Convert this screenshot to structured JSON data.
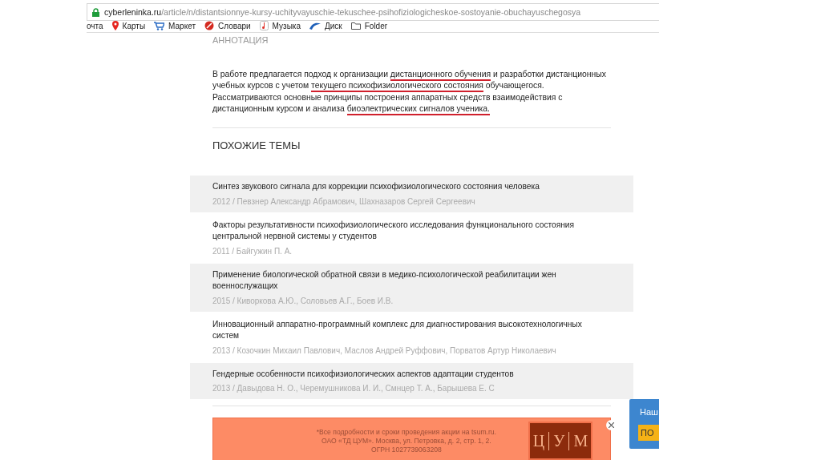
{
  "address_bar": {
    "domain": "cyberleninka.ru",
    "path": "/article/n/distantsionnye-kursy-uchityvayuschie-tekuschee-psihofiziologicheskoe-sostoyanie-obuchayuschegosya"
  },
  "bookmarks": [
    {
      "label": "очта",
      "kind": "none"
    },
    {
      "label": "Карты",
      "kind": "pin"
    },
    {
      "label": "Маркет",
      "kind": "cart"
    },
    {
      "label": "Словари",
      "kind": "dictionary"
    },
    {
      "label": "Музыка",
      "kind": "music"
    },
    {
      "label": "Диск",
      "kind": "disk"
    },
    {
      "label": "Folder",
      "kind": "folder"
    }
  ],
  "annotation": {
    "heading": "АННОТАЦИЯ",
    "segments": [
      {
        "text": "В работе предлагается подход к организации ",
        "underlined": false
      },
      {
        "text": "дистанционного обучения",
        "underlined": true
      },
      {
        "text": " и разработки дистанционных учебных курсов с учетом ",
        "underlined": false
      },
      {
        "text": "текущего психофизиологического состояния",
        "underlined": true
      },
      {
        "text": " обучающегося. Рассматриваются основные принципы построения аппаратных средств взаимодействия с дистанционным курсом и анализа ",
        "underlined": false
      },
      {
        "text": "биоэлектрических сигналов ученика.",
        "underlined": true
      }
    ]
  },
  "related": {
    "heading": "ПОХОЖИЕ ТЕМЫ",
    "items": [
      {
        "title": "Синтез звукового сигнала для коррекции психофизиологического состояния человека",
        "meta": "2012 / Певзнер Александр Абрамович, Шахназаров Сергей Сергеевич"
      },
      {
        "title": "Факторы результативности психофизиологического исследования функционального состояния центральной нервной системы у студентов",
        "meta": "2011 / Байгужин П. А."
      },
      {
        "title": "Применение биологической обратной связи в медико-психологической реабилитации жен военнослужащих",
        "meta": "2015 / Киворкова А.Ю., Соловьев А.Г., Боев И.В."
      },
      {
        "title": "Инновационный аппаратно-программный комплекс для диагностирования высокотехнологичных систем",
        "meta": "2013 / Козочкин Михаил Павлович, Маслов Андрей Руффович, Порватов Артур Николаевич"
      },
      {
        "title": "Гендерные особенности психофизиологических аспектов адаптации студентов",
        "meta": "2013 / Давыдова Н. О., Черемушникова И. И., Смнцер Т. А., Барышева Е. С"
      }
    ]
  },
  "ad": {
    "lines": [
      "*Все подробности и сроки проведения акции на tsum.ru.",
      "ОАО «ТД ЦУМ». Москва, ул. Петровка, д. 2, стр. 1, 2.",
      "ОГРН 1027739063208"
    ],
    "logo": [
      "Ц",
      "У",
      "М"
    ]
  },
  "side_widget": {
    "text": "Наш",
    "button": "ПО"
  }
}
